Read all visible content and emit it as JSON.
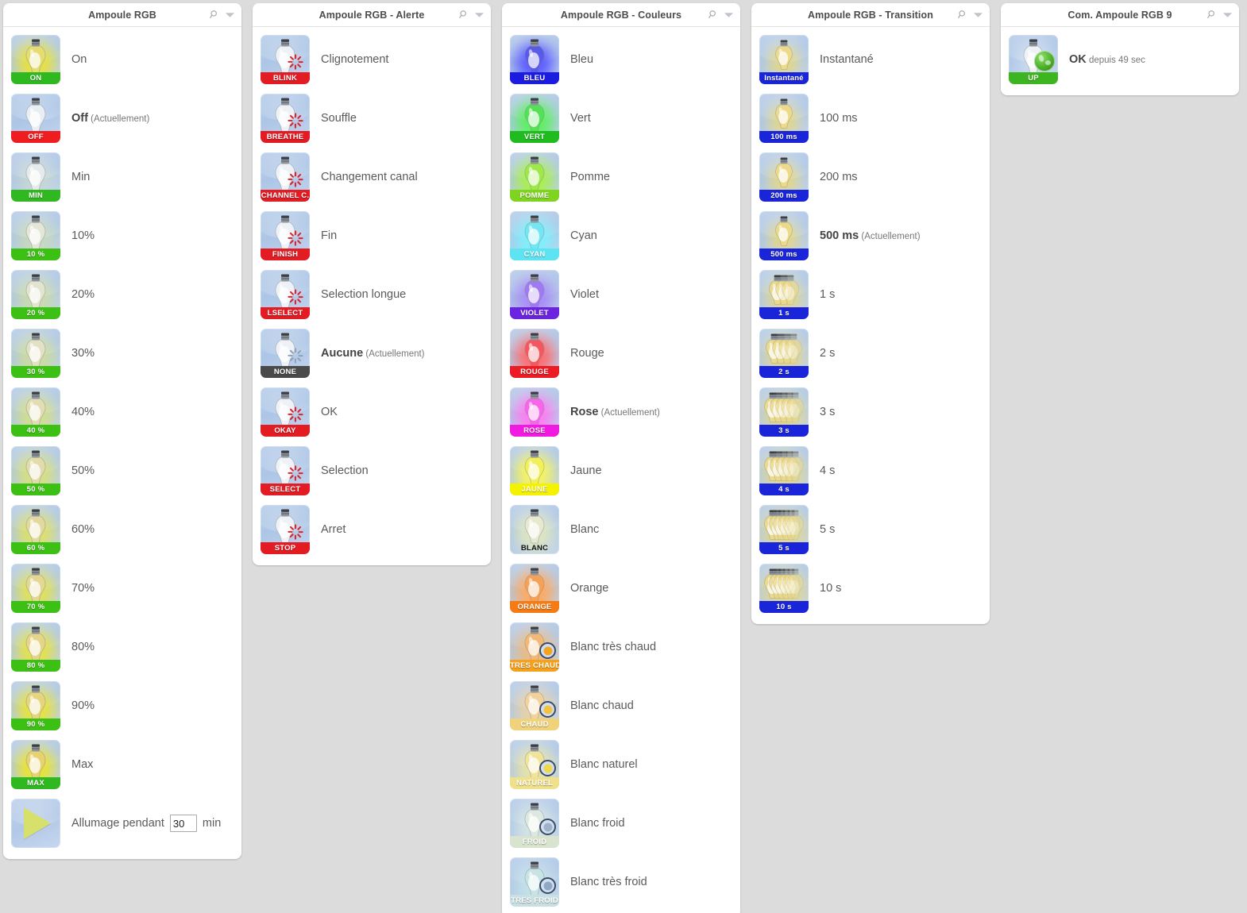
{
  "panels": [
    {
      "title": "Ampoule RGB",
      "kind": "level",
      "rows": [
        {
          "label": "On",
          "badge": "ON",
          "badge_color": "#2fb81f",
          "glow": "#e8e23a",
          "bulb": "#e6dd72",
          "current": false
        },
        {
          "label": "Off",
          "badge": "OFF",
          "badge_color": "#ef1c20",
          "glow": "rgba(255,255,255,0)",
          "bulb": "#e9eef3",
          "current": true,
          "current_text": "(Actuellement)"
        },
        {
          "label": "Min",
          "badge": "MIN",
          "badge_color": "#2fb81f",
          "glow": "rgba(236,240,180,0.35)",
          "bulb": "#e6eaea",
          "current": false
        },
        {
          "label": "10%",
          "badge": "10 %",
          "badge_color": "#3cc013",
          "glow": "rgba(225,235,140,0.45)",
          "bulb": "#e4e6d8",
          "current": false
        },
        {
          "label": "20%",
          "badge": "20 %",
          "badge_color": "#3cc013",
          "glow": "rgba(222,233,125,0.55)",
          "bulb": "#e3e4cf",
          "current": false
        },
        {
          "label": "30%",
          "badge": "30 %",
          "badge_color": "#3cc013",
          "glow": "rgba(221,231,115,0.62)",
          "bulb": "#e2e1c4",
          "current": false
        },
        {
          "label": "40%",
          "badge": "40 %",
          "badge_color": "#3cc013",
          "glow": "rgba(224,231,105,0.70)",
          "bulb": "#e2ddb4",
          "current": false
        },
        {
          "label": "50%",
          "badge": "50 %",
          "badge_color": "#3cc013",
          "glow": "rgba(226,230,95,0.78)",
          "bulb": "#e2dbab",
          "current": false
        },
        {
          "label": "60%",
          "badge": "60 %",
          "badge_color": "#3cc013",
          "glow": "rgba(228,229,82,0.85)",
          "bulb": "#e3d9a0",
          "current": false
        },
        {
          "label": "70%",
          "badge": "70 %",
          "badge_color": "#3cc013",
          "glow": "rgba(230,228,70,0.90)",
          "bulb": "#e4d793",
          "current": false
        },
        {
          "label": "80%",
          "badge": "80 %",
          "badge_color": "#3cc013",
          "glow": "rgba(232,228,60,0.94)",
          "bulb": "#e5d588",
          "current": false
        },
        {
          "label": "90%",
          "badge": "90 %",
          "badge_color": "#3cc013",
          "glow": "rgba(234,228,52,0.97)",
          "bulb": "#e6d47e",
          "current": false
        },
        {
          "label": "Max",
          "badge": "MAX",
          "badge_color": "#2fb81f",
          "glow": "rgba(236,228,45,1)",
          "bulb": "#e7d271",
          "current": false
        }
      ],
      "timer": {
        "prefix": "Allumage pendant",
        "value": "30",
        "suffix": "min"
      }
    },
    {
      "title": "Ampoule RGB - Alerte",
      "kind": "alert",
      "rows": [
        {
          "label": "Clignotement",
          "badge": "BLINK",
          "badge_color": "#e31b23",
          "burst": "#e02029",
          "current": false
        },
        {
          "label": "Souffle",
          "badge": "BREATHE",
          "badge_color": "#e31b23",
          "burst": "#e02029",
          "current": false
        },
        {
          "label": "Changement canal",
          "badge": "CHANNEL C.",
          "badge_color": "#e31b23",
          "burst": "#e02029",
          "current": false
        },
        {
          "label": "Fin",
          "badge": "FINISH",
          "badge_color": "#e31b23",
          "burst": "#e02029",
          "current": false
        },
        {
          "label": "Selection longue",
          "badge": "LSELECT",
          "badge_color": "#e31b23",
          "burst": "#e02029",
          "current": false
        },
        {
          "label": "Aucune",
          "badge": "NONE",
          "badge_color": "#4a4a4a",
          "burst": "#8ea2b8",
          "current": true,
          "current_text": "(Actuellement)"
        },
        {
          "label": "OK",
          "badge": "OKAY",
          "badge_color": "#e31b23",
          "burst": "#e02029",
          "current": false
        },
        {
          "label": "Selection",
          "badge": "SELECT",
          "badge_color": "#e31b23",
          "burst": "#e02029",
          "current": false
        },
        {
          "label": "Arret",
          "badge": "STOP",
          "badge_color": "#e31b23",
          "burst": "#e02029",
          "current": false
        }
      ]
    },
    {
      "title": "Ampoule RGB - Couleurs",
      "kind": "color",
      "rows": [
        {
          "label": "Bleu",
          "badge": "BLEU",
          "badge_color": "#1c1ce0",
          "glow": "#5b5bff",
          "bulb": "#5a5ae8",
          "current": false
        },
        {
          "label": "Vert",
          "badge": "VERT",
          "badge_color": "#1fbb1f",
          "glow": "#5cf05c",
          "bulb": "#55e055",
          "current": false
        },
        {
          "label": "Pomme",
          "badge": "POMME",
          "badge_color": "#7fd420",
          "glow": "#a9f04d",
          "bulb": "#9ee84a",
          "current": false
        },
        {
          "label": "Cyan",
          "badge": "CYAN",
          "badge_color": "#5de3f2",
          "glow": "#7ff0fb",
          "bulb": "#74e6f3",
          "current": false
        },
        {
          "label": "Violet",
          "badge": "VIOLET",
          "badge_color": "#6b23e0",
          "glow": "#a78bf5",
          "bulb": "#9f7af0",
          "current": false
        },
        {
          "label": "Rouge",
          "badge": "ROUGE",
          "badge_color": "#ec1c24",
          "glow": "#ff6a6a",
          "bulb": "#f4585e",
          "current": false
        },
        {
          "label": "Rose",
          "badge": "ROSE",
          "badge_color": "#f01ae0",
          "glow": "#ff7af0",
          "bulb": "#f765e8",
          "current": true,
          "current_text": "(Actuellement)"
        },
        {
          "label": "Jaune",
          "badge": "JAUNE",
          "badge_color": "#f5f200",
          "glow": "#f7f55c",
          "bulb": "#f2ef5a",
          "current": false
        },
        {
          "label": "Blanc",
          "badge": "BLANC",
          "badge_color": "transparent",
          "badge_dark": true,
          "glow": "rgba(229,235,185,0.85)",
          "bulb": "#e7e8cf",
          "current": false
        },
        {
          "label": "Orange",
          "badge": "ORANGE",
          "badge_color": "#f57b12",
          "glow": "#ffa95c",
          "bulb": "#f4a259",
          "current": false
        },
        {
          "label": "Blanc très chaud",
          "badge": "TRES CHAUD",
          "badge_color": "#f7a11b",
          "glow": "rgba(247,183,110,0.85)",
          "bulb": "#f2b878",
          "ring": "#f5a21e",
          "current": false
        },
        {
          "label": "Blanc chaud",
          "badge": "CHAUD",
          "badge_color": "#f0d27a",
          "glow": "rgba(247,212,150,0.8)",
          "bulb": "#f0d29a",
          "ring": "#f5c23e",
          "current": false
        },
        {
          "label": "Blanc naturel",
          "badge": "NATUREL",
          "badge_color": "#f0e08a",
          "glow": "rgba(246,235,150,0.8)",
          "bulb": "#efe49a",
          "ring": "#f0d84a",
          "current": false
        },
        {
          "label": "Blanc froid",
          "badge": "FROID",
          "badge_color": "#d8e4cd",
          "glow": "rgba(222,236,226,0.8)",
          "bulb": "#dde9e0",
          "ring": "#9fb2c8",
          "current": false
        },
        {
          "label": "Blanc très froid",
          "badge": "TRES FROID",
          "badge_color": "#c9e0e2",
          "glow": "rgba(200,230,232,0.85)",
          "bulb": "#c8e3e4",
          "ring": "#8fa8c4",
          "current": false
        }
      ]
    },
    {
      "title": "Ampoule RGB - Transition",
      "kind": "transition",
      "rows": [
        {
          "label": "Instantané",
          "badge": "Instantané",
          "badge_color": "#1a24d8",
          "bulbs": 1,
          "current": false
        },
        {
          "label": "100 ms",
          "badge": "100 ms",
          "badge_color": "#1a24d8",
          "bulbs": 1,
          "current": false
        },
        {
          "label": "200 ms",
          "badge": "200 ms",
          "badge_color": "#1a24d8",
          "bulbs": 1,
          "current": false
        },
        {
          "label": "500 ms",
          "badge": "500 ms",
          "badge_color": "#1a24d8",
          "bulbs": 1,
          "current": true,
          "current_text": "(Actuellement)"
        },
        {
          "label": "1 s",
          "badge": "1 s",
          "badge_color": "#1a24d8",
          "bulbs": 3,
          "current": false
        },
        {
          "label": "2 s",
          "badge": "2 s",
          "badge_color": "#1a24d8",
          "bulbs": 4,
          "current": false
        },
        {
          "label": "3 s",
          "badge": "3 s",
          "badge_color": "#1a24d8",
          "bulbs": 5,
          "current": false
        },
        {
          "label": "4 s",
          "badge": "4 s",
          "badge_color": "#1a24d8",
          "bulbs": 5,
          "current": false
        },
        {
          "label": "5 s",
          "badge": "5 s",
          "badge_color": "#1a24d8",
          "bulbs": 6,
          "current": false
        },
        {
          "label": "10 s",
          "badge": "10 s",
          "badge_color": "#1a24d8",
          "bulbs": 6,
          "current": false
        }
      ]
    },
    {
      "title": "Com. Ampoule RGB 9",
      "kind": "com",
      "rows": [
        {
          "label": "OK",
          "suffix": "depuis 49 sec",
          "badge": "UP",
          "badge_color": "#3cb521",
          "current": true
        }
      ]
    }
  ],
  "icons": {
    "search": "search-icon",
    "chevron": "chevron-down-icon"
  }
}
